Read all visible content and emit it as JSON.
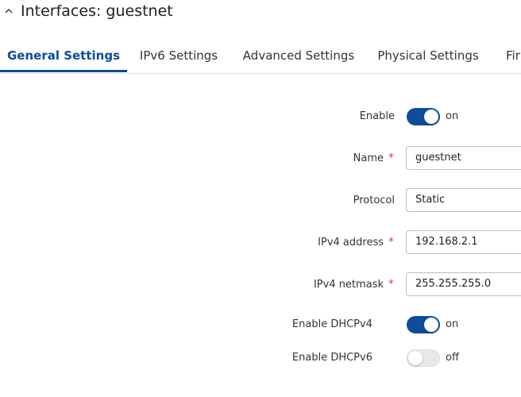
{
  "header": {
    "title": "Interfaces: guestnet",
    "collapse_icon": "chevron-up-icon"
  },
  "tabs": [
    {
      "label": "General Settings",
      "active": true
    },
    {
      "label": "IPv6 Settings",
      "active": false
    },
    {
      "label": "Advanced Settings",
      "active": false
    },
    {
      "label": "Physical Settings",
      "active": false
    },
    {
      "label": "Fir",
      "active": false
    }
  ],
  "colors": {
    "accent": "#0f4c97",
    "required": "#d64541"
  },
  "form": {
    "enable": {
      "label": "Enable",
      "state": "on"
    },
    "name": {
      "label": "Name",
      "required_mark": "*",
      "value": "guestnet"
    },
    "protocol": {
      "label": "Protocol",
      "value": "Static"
    },
    "ipv4_address": {
      "label": "IPv4 address",
      "required_mark": "*",
      "value": "192.168.2.1"
    },
    "ipv4_netmask": {
      "label": "IPv4 netmask",
      "required_mark": "*",
      "value": "255.255.255.0"
    },
    "enable_dhcpv4": {
      "label": "Enable DHCPv4",
      "state": "on"
    },
    "enable_dhcpv6": {
      "label": "Enable DHCPv6",
      "state": "off"
    }
  }
}
